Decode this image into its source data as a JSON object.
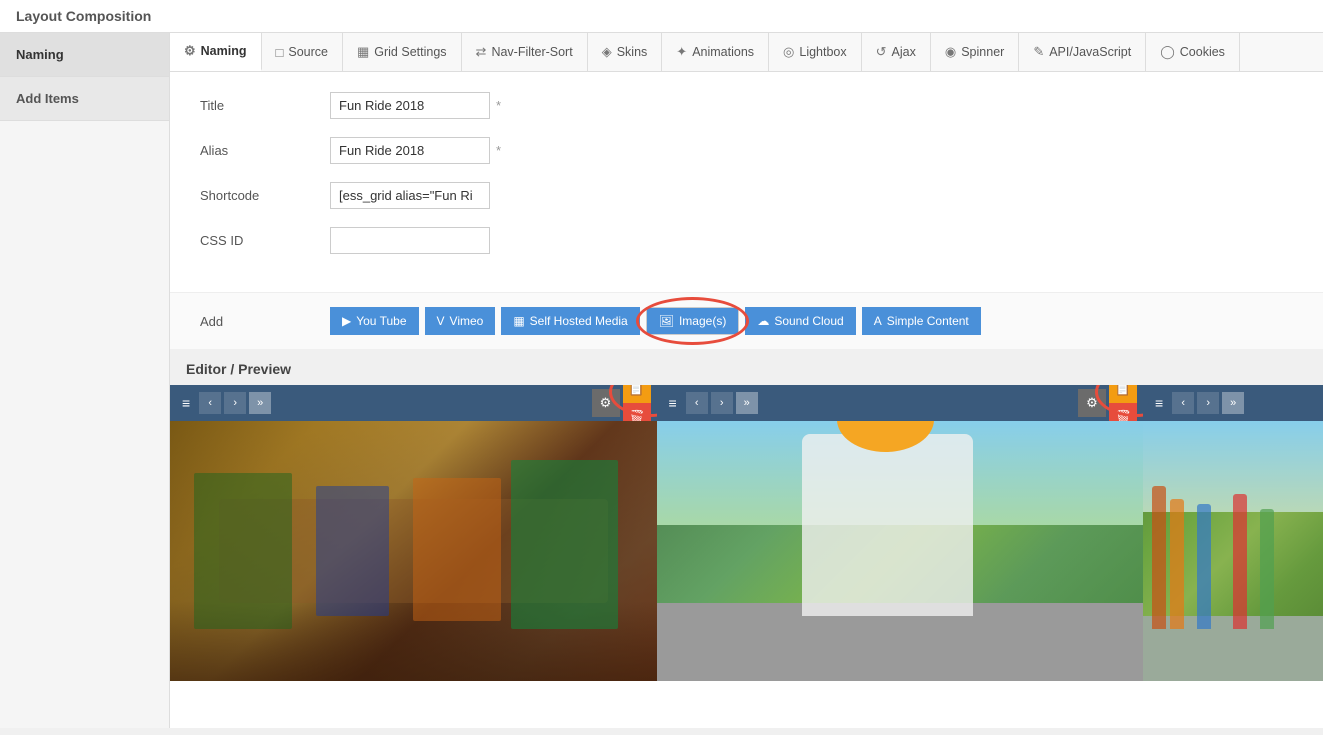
{
  "titleBar": {
    "label": "Layout Composition"
  },
  "sidebar": {
    "items": [
      {
        "id": "naming",
        "label": "Naming",
        "active": true
      },
      {
        "id": "add-items",
        "label": "Add Items",
        "active": false
      }
    ]
  },
  "tabs": [
    {
      "id": "naming",
      "label": "Naming",
      "icon": "⚙",
      "active": true
    },
    {
      "id": "source",
      "label": "Source",
      "icon": "□",
      "active": false
    },
    {
      "id": "grid-settings",
      "label": "Grid Settings",
      "icon": "▦",
      "active": false
    },
    {
      "id": "nav-filter-sort",
      "label": "Nav-Filter-Sort",
      "icon": "⇄",
      "active": false
    },
    {
      "id": "skins",
      "label": "Skins",
      "icon": "◈",
      "active": false
    },
    {
      "id": "animations",
      "label": "Animations",
      "icon": "✦",
      "active": false
    },
    {
      "id": "lightbox",
      "label": "Lightbox",
      "icon": "◎",
      "active": false
    },
    {
      "id": "ajax",
      "label": "Ajax",
      "icon": "↺",
      "active": false
    },
    {
      "id": "spinner",
      "label": "Spinner",
      "icon": "◉",
      "active": false
    },
    {
      "id": "api-javascript",
      "label": "API/JavaScript",
      "icon": "✎",
      "active": false
    },
    {
      "id": "cookies",
      "label": "Cookies",
      "icon": "◯",
      "active": false
    }
  ],
  "form": {
    "titleLabel": "Title",
    "titleValue": "Fun Ride 2018",
    "titleRequired": "*",
    "aliasLabel": "Alias",
    "aliasValue": "Fun Ride 2018",
    "aliasRequired": "*",
    "shortcodeLabel": "Shortcode",
    "shortcodeValue": "[ess_grid alias=\"Fun Ri",
    "cssIdLabel": "CSS ID",
    "cssIdValue": ""
  },
  "addItems": {
    "label": "Add",
    "addLabel": "Add Items",
    "buttons": [
      {
        "id": "youtube",
        "label": "You Tube",
        "icon": "▶"
      },
      {
        "id": "vimeo",
        "label": "Vimeo",
        "icon": "V"
      },
      {
        "id": "self-hosted",
        "label": "Self Hosted Media",
        "icon": "▦"
      },
      {
        "id": "images",
        "label": "Image(s)",
        "icon": "🖼",
        "highlighted": true
      },
      {
        "id": "soundcloud",
        "label": "Sound Cloud",
        "icon": "☁"
      },
      {
        "id": "simple-content",
        "label": "Simple Content",
        "icon": "A"
      }
    ]
  },
  "editorPreview": {
    "title": "Editor / Preview"
  },
  "previewItems": [
    {
      "id": "item-1",
      "hasHighlight": false
    },
    {
      "id": "item-2",
      "hasHighlight": true
    },
    {
      "id": "item-3",
      "hasHighlight": false
    }
  ],
  "toolbar": {
    "hamburger": "≡",
    "prevBtn": "‹",
    "nextBtn": "›",
    "lastBtn": "»",
    "gearIcon": "⚙",
    "copyIcon": "📋",
    "trashIcon": "🗑"
  }
}
